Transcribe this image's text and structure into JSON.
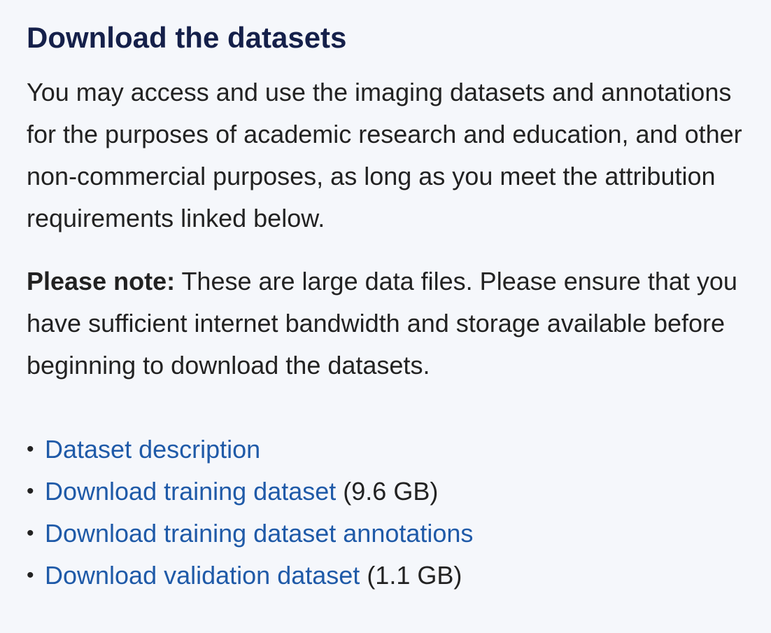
{
  "page": {
    "title": "Download the datasets",
    "intro": "You may access and use the imaging datasets and annotations for the purposes of academic research and education, and other non-commercial purposes, as long as you meet the attribution requirements linked below.",
    "note_label": "Please note:",
    "note_text": " These are large data files. Please ensure that you have sufficient internet bandwidth and storage available before beginning to download the datasets."
  },
  "links": [
    {
      "label": "Dataset description",
      "size": ""
    },
    {
      "label": "Download training dataset",
      "size": " (9.6 GB)"
    },
    {
      "label": "Download training dataset annotations",
      "size": ""
    },
    {
      "label": "Download validation dataset",
      "size": " (1.1 GB)"
    }
  ],
  "colors": {
    "background": "#f5f7fb",
    "heading": "#15204a",
    "link": "#1f5aa8",
    "text": "#222222"
  }
}
